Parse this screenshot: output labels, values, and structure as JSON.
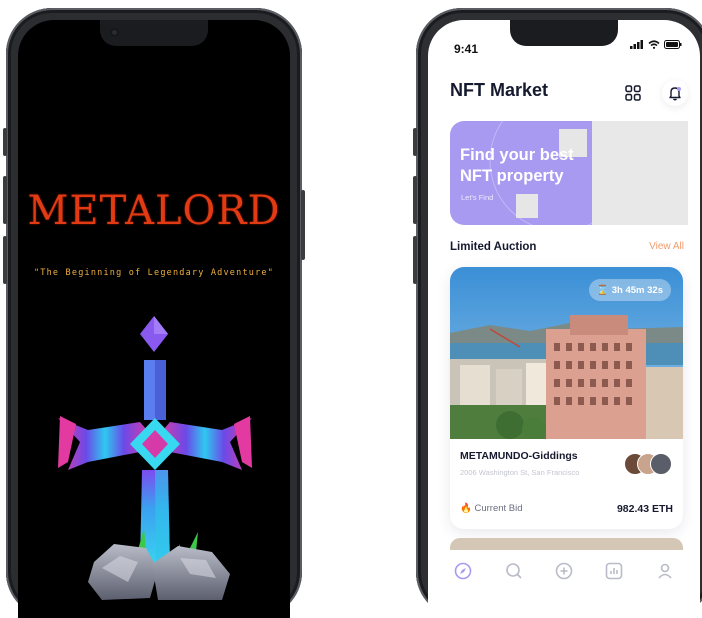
{
  "game": {
    "title": "METALORD",
    "subtitle": "\"The Beginning of Legendary Adventure\""
  },
  "status_bar": {
    "time": "9:41"
  },
  "header": {
    "title": "NFT Market",
    "icons": [
      "grid-icon",
      "bell-icon"
    ]
  },
  "banner": {
    "title_line1": "Find your best",
    "title_line2": "NFT property",
    "subtitle": "Let's Find"
  },
  "auction": {
    "section_title": "Limited Auction",
    "view_all": "View All",
    "card": {
      "timer": "3h 45m 32s",
      "name": "METAMUNDO-Giddings",
      "address": "2006 Washington St, San Francisco",
      "bid_label": "Current Bid",
      "bid_value": "982.43 ETH"
    }
  },
  "tabbar": {
    "items": [
      "compass-icon",
      "search-icon",
      "plus-icon",
      "chart-icon",
      "profile-icon"
    ],
    "active": "compass-icon"
  },
  "colors": {
    "accent": "#a79af0",
    "view_all": "#f39b6b",
    "game_title": "#e23a12"
  }
}
